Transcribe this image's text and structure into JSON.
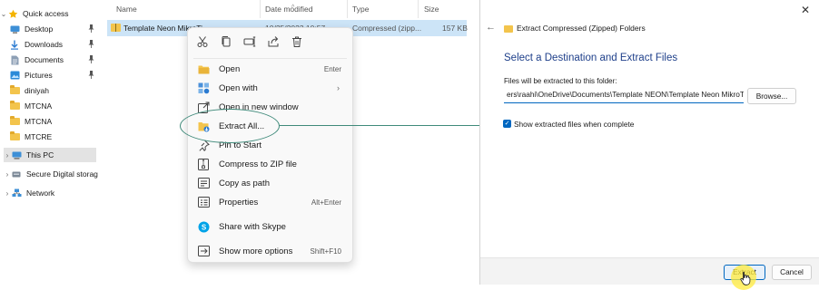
{
  "nav": {
    "items": [
      {
        "label": "Quick access",
        "icon": "star-icon",
        "expandable": true,
        "expanded": true
      },
      {
        "label": "Desktop",
        "icon": "desktop-icon",
        "pinned": true
      },
      {
        "label": "Downloads",
        "icon": "download-icon",
        "pinned": true
      },
      {
        "label": "Documents",
        "icon": "documents-icon",
        "pinned": true
      },
      {
        "label": "Pictures",
        "icon": "pictures-icon",
        "pinned": true
      },
      {
        "label": "diniyah",
        "icon": "folder-icon"
      },
      {
        "label": "MTCNA",
        "icon": "folder-icon"
      },
      {
        "label": "MTCNA",
        "icon": "folder-icon"
      },
      {
        "label": "MTCRE",
        "icon": "folder-icon"
      },
      {
        "label": "This PC",
        "icon": "pc-icon",
        "expandable": true,
        "selected": true
      },
      {
        "label": "Secure Digital storag",
        "icon": "sd-card-icon",
        "expandable": true
      },
      {
        "label": "Network",
        "icon": "network-icon",
        "expandable": true
      }
    ]
  },
  "file_list": {
    "columns": [
      "Name",
      "Date modified",
      "Type",
      "Size"
    ],
    "row": {
      "name": "Template Neon MikroTi",
      "date": "10/25/2023 10:57",
      "type": "Compressed (zipp...",
      "size": "157 KB"
    }
  },
  "context_menu": {
    "toolbar": [
      {
        "name": "cut-icon"
      },
      {
        "name": "copy-icon"
      },
      {
        "name": "rename-icon"
      },
      {
        "name": "share-icon"
      },
      {
        "name": "delete-icon"
      }
    ],
    "items": [
      {
        "label": "Open",
        "shortcut": "Enter",
        "icon": "open-icon"
      },
      {
        "label": "Open with",
        "shortcut": "",
        "icon": "open-with-icon",
        "submenu": true
      },
      {
        "label": "Open in new window",
        "shortcut": "",
        "icon": "new-window-icon"
      },
      {
        "label": "Extract All...",
        "shortcut": "",
        "icon": "extract-icon",
        "highlighted": true
      },
      {
        "label": "Pin to Start",
        "shortcut": "",
        "icon": "pin-icon"
      },
      {
        "label": "Compress to ZIP file",
        "shortcut": "",
        "icon": "zip-icon"
      },
      {
        "label": "Copy as path",
        "shortcut": "",
        "icon": "copy-path-icon"
      },
      {
        "label": "Properties",
        "shortcut": "Alt+Enter",
        "icon": "properties-icon"
      },
      {
        "label": "Share with Skype",
        "shortcut": "",
        "icon": "skype-icon"
      },
      {
        "label": "Show more options",
        "shortcut": "Shift+F10",
        "icon": "more-options-icon"
      }
    ]
  },
  "dialog": {
    "title": "Extract Compressed (Zipped) Folders",
    "heading": "Select a Destination and Extract Files",
    "folder_label": "Files will be extracted to this folder:",
    "path": "ers\\raahi\\OneDrive\\Documents\\Template NEON\\Template Neon MikroTik",
    "browse_label": "Browse...",
    "checkbox_label": "Show extracted files when complete",
    "checkbox_checked": true,
    "extract_label": "Extract",
    "cancel_label": "Cancel"
  },
  "colors": {
    "accent": "#0067c0",
    "heading": "#1e3f8a",
    "annotation": "#3f8a7a",
    "selection": "#cce4f7",
    "folder": "#f3c44c"
  }
}
